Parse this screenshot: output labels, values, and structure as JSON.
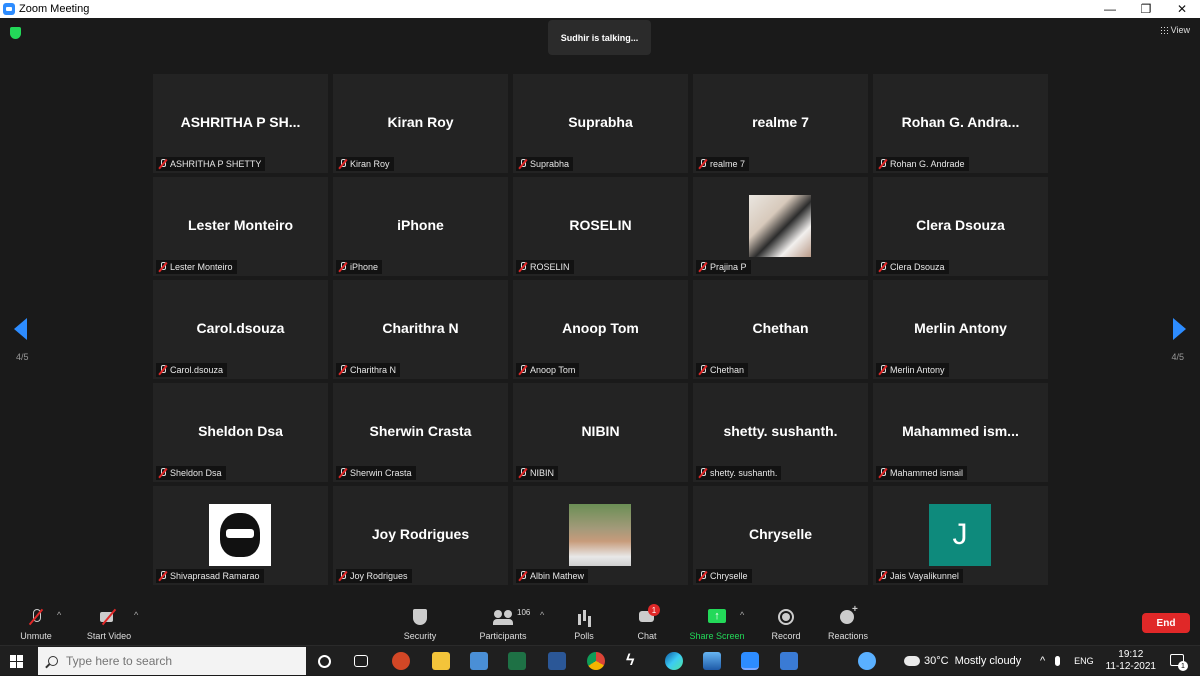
{
  "window": {
    "title": "Zoom Meeting",
    "minimize": "—",
    "maximize": "❐",
    "close": "✕"
  },
  "header": {
    "talking": "Sudhir is talking...",
    "view_label": "View"
  },
  "pagination": {
    "left": "4/5",
    "right": "4/5"
  },
  "participants": [
    {
      "display": "ASHRITHA P SH...",
      "label": "ASHRITHA P SHETTY"
    },
    {
      "display": "Kiran Roy",
      "label": "Kiran Roy"
    },
    {
      "display": "Suprabha",
      "label": "Suprabha"
    },
    {
      "display": "realme 7",
      "label": "realme 7"
    },
    {
      "display": "Rohan G. Andra...",
      "label": "Rohan G. Andrade"
    },
    {
      "display": "Lester Monteiro",
      "label": "Lester Monteiro"
    },
    {
      "display": "iPhone",
      "label": "iPhone"
    },
    {
      "display": "ROSELIN",
      "label": "ROSELIN"
    },
    {
      "display": "",
      "label": "Prajina P",
      "photo": "prajina"
    },
    {
      "display": "Clera Dsouza",
      "label": "Clera Dsouza"
    },
    {
      "display": "Carol.dsouza",
      "label": "Carol.dsouza"
    },
    {
      "display": "Charithra N",
      "label": "Charithra N"
    },
    {
      "display": "Anoop Tom",
      "label": "Anoop Tom"
    },
    {
      "display": "Chethan",
      "label": "Chethan"
    },
    {
      "display": "Merlin Antony",
      "label": "Merlin Antony"
    },
    {
      "display": "Sheldon Dsa",
      "label": "Sheldon Dsa"
    },
    {
      "display": "Sherwin Crasta",
      "label": "Sherwin Crasta"
    },
    {
      "display": "NIBIN",
      "label": "NIBIN"
    },
    {
      "display": "shetty. sushanth.",
      "label": "shetty. sushanth."
    },
    {
      "display": "Mahammed  ism...",
      "label": "Mahammed ismail"
    },
    {
      "display": "",
      "label": "Shivaprasad Ramarao",
      "photo": "shiva"
    },
    {
      "display": "Joy Rodrigues",
      "label": "Joy Rodrigues"
    },
    {
      "display": "",
      "label": "Albin Mathew",
      "photo": "albin"
    },
    {
      "display": "Chryselle",
      "label": "Chryselle"
    },
    {
      "display": "",
      "label": "Jais Vayalikunnel",
      "avatar_letter": "J"
    }
  ],
  "toolbar": {
    "unmute": "Unmute",
    "start_video": "Start Video",
    "security": "Security",
    "participants": "Participants",
    "participants_count": "106",
    "polls": "Polls",
    "chat": "Chat",
    "chat_badge": "1",
    "share_screen": "Share Screen",
    "record": "Record",
    "reactions": "Reactions",
    "end": "End",
    "caret": "^"
  },
  "taskbar": {
    "search_placeholder": "Type here to search",
    "temperature": "30°C",
    "weather": "Mostly cloudy",
    "lang": "ENG",
    "time": "19:12",
    "date": "11-12-2021",
    "notifications": "1",
    "tray_arrow": "^"
  }
}
